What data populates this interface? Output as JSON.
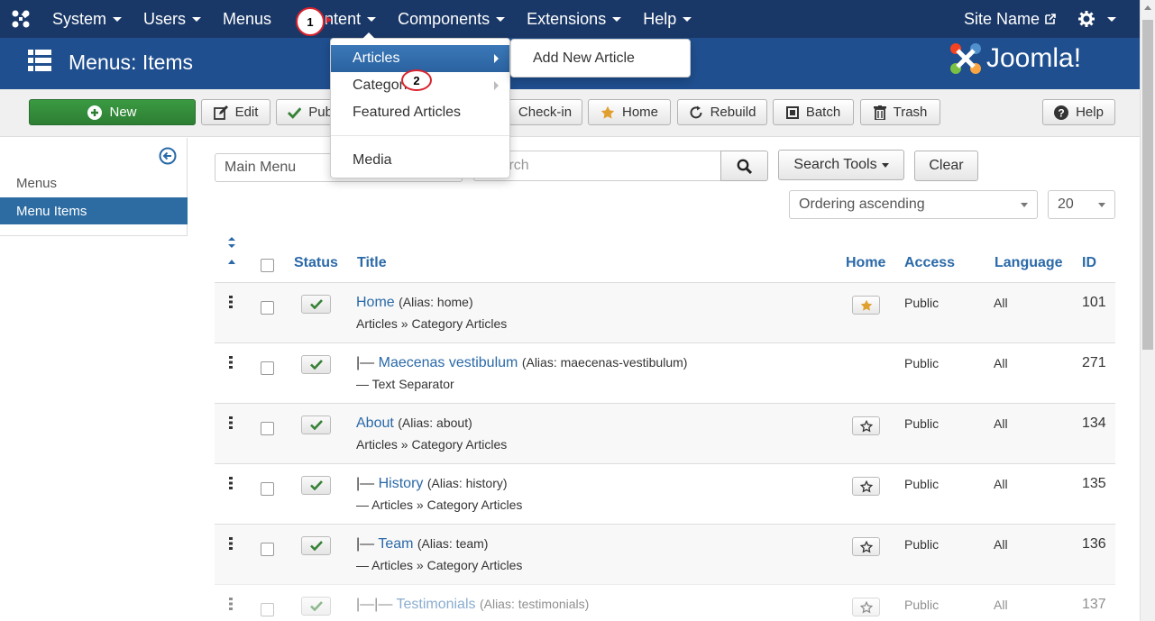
{
  "topnav": {
    "items": [
      "System",
      "Users",
      "Menus",
      "Content",
      "Components",
      "Extensions",
      "Help"
    ],
    "site_name": "Site Name"
  },
  "header": {
    "title": "Menus: Items",
    "brand": "Joomla!"
  },
  "toolbar": {
    "new": "New",
    "edit": "Edit",
    "publish": "Pub",
    "checkin": "Check-in",
    "home": "Home",
    "rebuild": "Rebuild",
    "batch": "Batch",
    "trash": "Trash",
    "help": "Help"
  },
  "sidebar": {
    "items": [
      "Menus",
      "Menu Items"
    ]
  },
  "filters": {
    "menu": "Main Menu",
    "search_placeholder": "Search",
    "search_tools": "Search Tools",
    "clear": "Clear",
    "ordering": "Ordering ascending",
    "limit": "20"
  },
  "table": {
    "headers": {
      "status": "Status",
      "title": "Title",
      "home": "Home",
      "access": "Access",
      "language": "Language",
      "id": "ID"
    },
    "rows": [
      {
        "prefix": "",
        "title": "Home",
        "alias": "(Alias: home)",
        "sub": "Articles » Category Articles",
        "home": "default",
        "access": "Public",
        "language": "All",
        "id": "101"
      },
      {
        "prefix": "|— ",
        "title": "Maecenas vestibulum",
        "alias": "(Alias: maecenas-vestibulum)",
        "sub": "— Text Separator",
        "home": "none",
        "access": "Public",
        "language": "All",
        "id": "271"
      },
      {
        "prefix": "",
        "title": "About",
        "alias": "(Alias: about)",
        "sub": "Articles » Category Articles",
        "home": "star",
        "access": "Public",
        "language": "All",
        "id": "134"
      },
      {
        "prefix": "|— ",
        "title": "History",
        "alias": "(Alias: history)",
        "sub": "— Articles » Category Articles",
        "home": "star",
        "access": "Public",
        "language": "All",
        "id": "135"
      },
      {
        "prefix": "|— ",
        "title": "Team",
        "alias": "(Alias: team)",
        "sub": "— Articles » Category Articles",
        "home": "star",
        "access": "Public",
        "language": "All",
        "id": "136"
      },
      {
        "prefix": "|—|— ",
        "title": "Testimonials",
        "alias": "(Alias: testimonials)",
        "sub": "",
        "home": "star",
        "access": "Public",
        "language": "All",
        "id": "137"
      }
    ]
  },
  "content_dropdown": {
    "items": [
      "Articles",
      "Categories",
      "Featured Articles",
      "Media"
    ],
    "visible_categories": "Categori"
  },
  "articles_submenu": {
    "items": [
      "Add New Article"
    ]
  },
  "markers": [
    "1",
    "2"
  ],
  "colors": {
    "topnav": "#1a3867",
    "header": "#1f4f8f",
    "link": "#2a69a8",
    "new_button": "#3b9a42",
    "check": "#378137",
    "star": "#e0a030"
  }
}
